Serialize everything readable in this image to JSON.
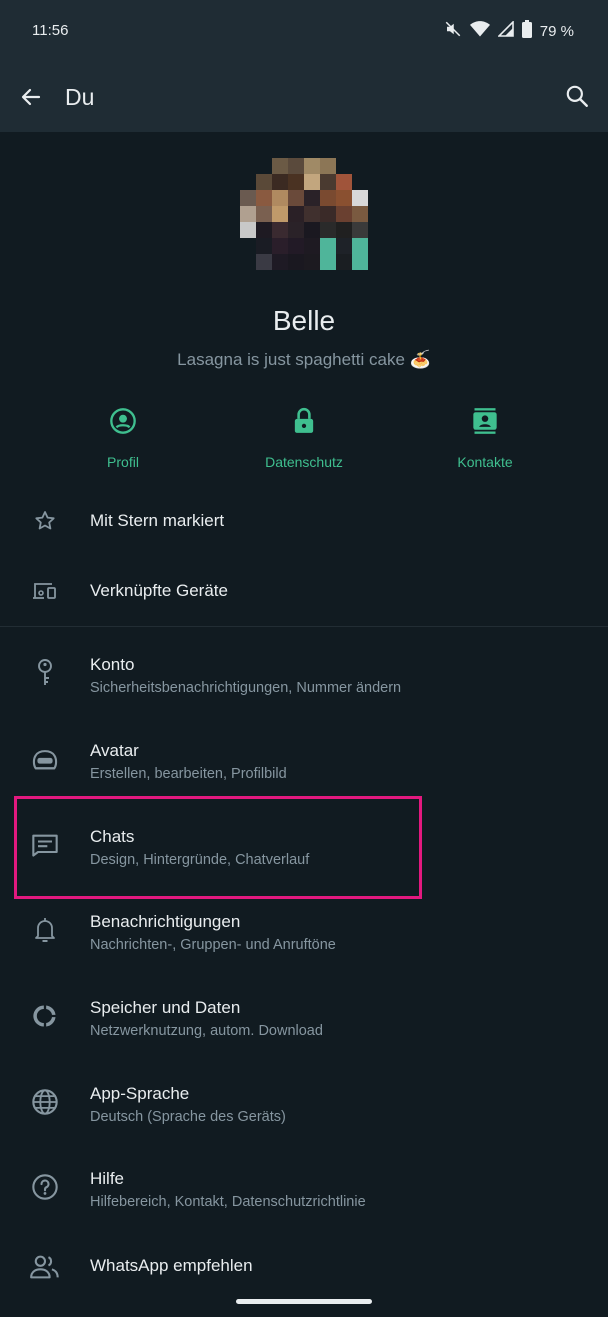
{
  "status_bar": {
    "time": "11:56",
    "battery": "79 %"
  },
  "header": {
    "title": "Du"
  },
  "profile": {
    "name": "Belle",
    "about": "Lasagna is just spaghetti cake 🍝"
  },
  "quick_actions": [
    {
      "label": "Profil",
      "icon": "profile-icon"
    },
    {
      "label": "Datenschutz",
      "icon": "lock-icon"
    },
    {
      "label": "Kontakte",
      "icon": "contacts-icon"
    }
  ],
  "menu": [
    {
      "title": "Mit Stern markiert",
      "subtitle": "",
      "icon": "star-icon"
    },
    {
      "title": "Verknüpfte Geräte",
      "subtitle": "",
      "icon": "devices-icon"
    },
    {
      "title": "Konto",
      "subtitle": "Sicherheitsbenachrichtigungen, Nummer ändern",
      "icon": "key-icon"
    },
    {
      "title": "Avatar",
      "subtitle": "Erstellen, bearbeiten, Profilbild",
      "icon": "avatar-icon"
    },
    {
      "title": "Chats",
      "subtitle": "Design, Hintergründe, Chatverlauf",
      "icon": "chat-icon"
    },
    {
      "title": "Benachrichtigungen",
      "subtitle": "Nachrichten-, Gruppen- und Anruftöne",
      "icon": "bell-icon"
    },
    {
      "title": "Speicher und Daten",
      "subtitle": "Netzwerknutzung, autom. Download",
      "icon": "storage-icon"
    },
    {
      "title": "App-Sprache",
      "subtitle": "Deutsch (Sprache des Geräts)",
      "icon": "globe-icon"
    },
    {
      "title": "Hilfe",
      "subtitle": "Hilfebereich, Kontakt, Datenschutzrichtlinie",
      "icon": "help-icon"
    },
    {
      "title": "WhatsApp empfehlen",
      "subtitle": "",
      "icon": "invite-icon"
    }
  ],
  "colors": {
    "background": "#111b21",
    "header": "#1f2c34",
    "accent": "#3fbf8f",
    "highlight": "#e3197f",
    "secondary_text": "#8696a0"
  }
}
